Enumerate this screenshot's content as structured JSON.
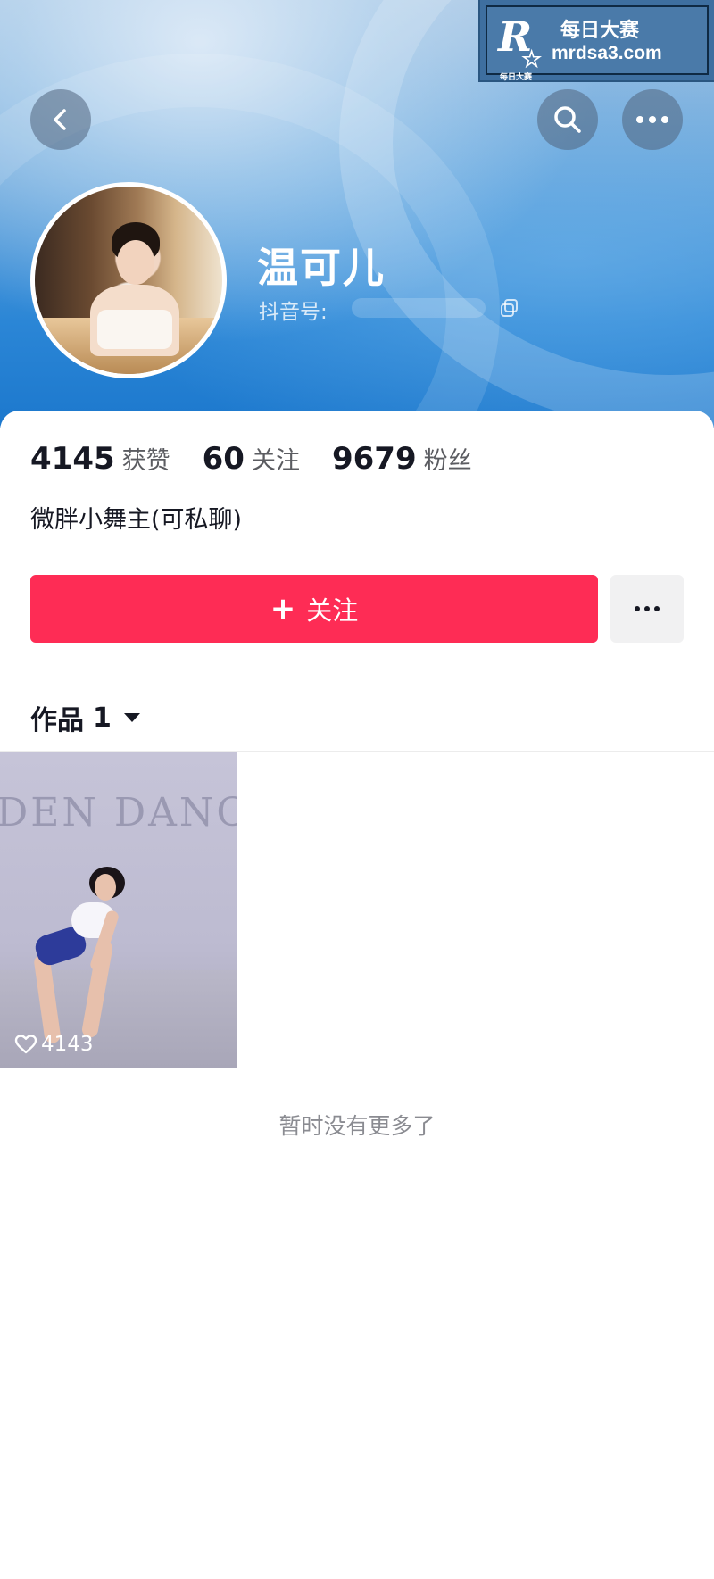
{
  "watermark": {
    "logo_letter": "R",
    "logo_small": "每日大赛",
    "title": "每日大赛",
    "url": "mrdsa3.com"
  },
  "nav": {
    "back_icon": "chevron-left-icon",
    "search_icon": "search-icon",
    "more_icon": "more-horizontal-icon"
  },
  "profile": {
    "name": "温可儿",
    "douyin_id_label": "抖音号:",
    "avatar_icon": "avatar"
  },
  "stats": [
    {
      "value": "4145",
      "label": "获赞"
    },
    {
      "value": "60",
      "label": "关注"
    },
    {
      "value": "9679",
      "label": "粉丝"
    }
  ],
  "bio": "微胖小舞主(可私聊)",
  "actions": {
    "follow_label": "关注",
    "follow_plus": "+",
    "accent_color": "#fe2c55"
  },
  "works": {
    "tab_label": "作品",
    "tab_count": "1",
    "items": [
      {
        "likes": "4143",
        "wall_text": "DEN DANC"
      }
    ]
  },
  "footer": {
    "end_text": "暂时没有更多了"
  }
}
